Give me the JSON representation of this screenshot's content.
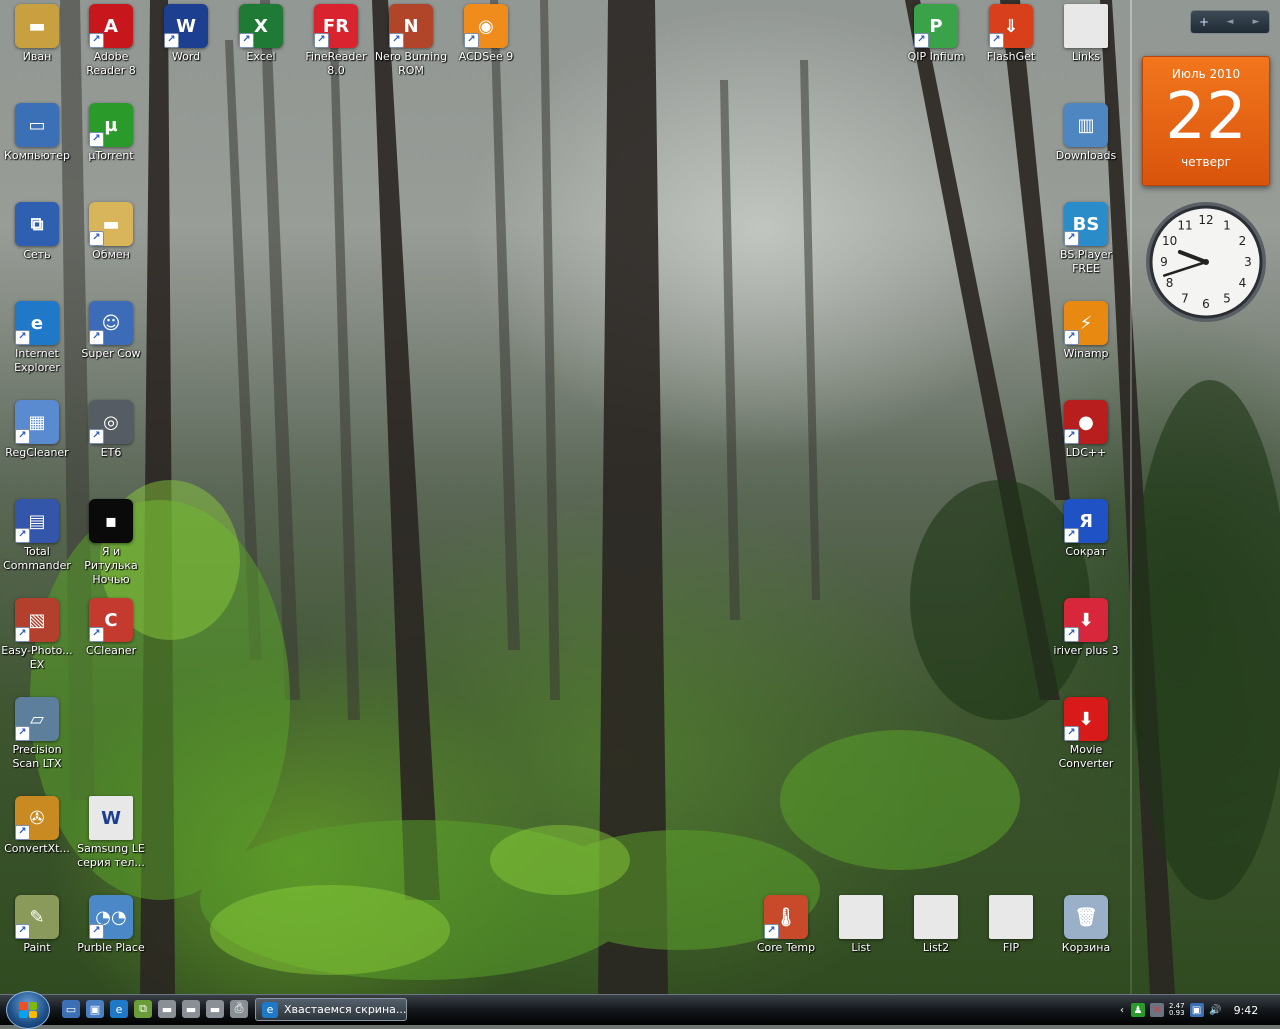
{
  "desktop": {
    "icons": [
      {
        "label": "Иван",
        "color": "#c8a040",
        "glyph": "▬",
        "shortcut": false
      },
      {
        "label": "Adobe Reader 8",
        "color": "#c8161d",
        "glyph": "A",
        "shortcut": true
      },
      {
        "label": "Word",
        "color": "#1d3f8f",
        "glyph": "W",
        "shortcut": true
      },
      {
        "label": "Excel",
        "color": "#1f7a35",
        "glyph": "X",
        "shortcut": true
      },
      {
        "label": "FineReader 8.0",
        "color": "#d9232e",
        "glyph": "FR",
        "shortcut": true
      },
      {
        "label": "Nero Burning ROM",
        "color": "#b0452a",
        "glyph": "N",
        "shortcut": true
      },
      {
        "label": "ACDSee 9",
        "color": "#f08c1c",
        "glyph": "◉",
        "shortcut": true
      },
      {
        "label": "Компьютер",
        "color": "#3b6fb6",
        "glyph": "▭",
        "shortcut": false
      },
      {
        "label": "µTorrent",
        "color": "#2a9b2a",
        "glyph": "µ",
        "shortcut": true
      },
      {
        "label": "Сеть",
        "color": "#2e5fb0",
        "glyph": "⧉",
        "shortcut": false
      },
      {
        "label": "Обмен",
        "color": "#d8b45a",
        "glyph": "▬",
        "shortcut": true
      },
      {
        "label": "Internet Explorer",
        "color": "#1f78c8",
        "glyph": "e",
        "shortcut": true
      },
      {
        "label": "Super Cow",
        "color": "#3c6cb8",
        "glyph": "☺",
        "shortcut": true
      },
      {
        "label": "RegCleaner",
        "color": "#5a8ad0",
        "glyph": "▦",
        "shortcut": true
      },
      {
        "label": "ET6",
        "color": "#555c63",
        "glyph": "◎",
        "shortcut": true
      },
      {
        "label": "Total Commander",
        "color": "#3355aa",
        "glyph": "▤",
        "shortcut": true
      },
      {
        "label": "Я и Ритулька Ночью",
        "color": "#0a0a0a",
        "glyph": "▪",
        "shortcut": false
      },
      {
        "label": "Easy-Photo... EX",
        "color": "#b2402c",
        "glyph": "▧",
        "shortcut": true
      },
      {
        "label": "CCleaner",
        "color": "#c43a2e",
        "glyph": "C",
        "shortcut": true
      },
      {
        "label": "Precision Scan LTX",
        "color": "#5d7f9c",
        "glyph": "▱",
        "shortcut": true
      },
      {
        "label": "ConvertXt...",
        "color": "#c98a22",
        "glyph": "✇",
        "shortcut": true
      },
      {
        "label": "Samsung LE серия тел...",
        "color": "#e8e8e8",
        "glyph": "W",
        "shortcut": false
      },
      {
        "label": "Paint",
        "color": "#8a9a5a",
        "glyph": "✎",
        "shortcut": true
      },
      {
        "label": "Purble Place",
        "color": "#4a88c8",
        "glyph": "◔◔",
        "shortcut": true
      },
      {
        "label": "QIP Infium",
        "color": "#3aa34a",
        "glyph": "P",
        "shortcut": true
      },
      {
        "label": "FlashGet",
        "color": "#d8401c",
        "glyph": "⇓",
        "shortcut": true
      },
      {
        "label": "Links",
        "color": "#e8e8e8",
        "glyph": "",
        "shortcut": false
      },
      {
        "label": "Downloads",
        "color": "#4d86c0",
        "glyph": "▥",
        "shortcut": false
      },
      {
        "label": "BS.Player FREE",
        "color": "#2a8cc8",
        "glyph": "BS",
        "shortcut": true
      },
      {
        "label": "Winamp",
        "color": "#e88a12",
        "glyph": "⚡",
        "shortcut": true
      },
      {
        "label": "LDC++",
        "color": "#b81e1e",
        "glyph": "●",
        "shortcut": true
      },
      {
        "label": "Сократ",
        "color": "#1f52c4",
        "glyph": "Я",
        "shortcut": true
      },
      {
        "label": "iriver plus 3",
        "color": "#d8263a",
        "glyph": "⬇",
        "shortcut": true
      },
      {
        "label": "Movie Converter",
        "color": "#d81a1a",
        "glyph": "⬇",
        "shortcut": true
      },
      {
        "label": "Core Temp",
        "color": "#c84a2a",
        "glyph": "🌡",
        "shortcut": true
      },
      {
        "label": "List",
        "color": "#e8e8e8",
        "glyph": "",
        "shortcut": false
      },
      {
        "label": "List2",
        "color": "#e8e8e8",
        "glyph": "",
        "shortcut": false
      },
      {
        "label": "FIP",
        "color": "#e8e8e8",
        "glyph": "",
        "shortcut": false
      },
      {
        "label": "Корзина",
        "color": "#9ab0c8",
        "glyph": "🗑",
        "shortcut": false
      }
    ]
  },
  "gadgets": {
    "toolbar": {
      "add": "+",
      "prev": "◄",
      "next": "►"
    },
    "calendar": {
      "month_year": "Июль 2010",
      "day": "22",
      "weekday": "четверг"
    },
    "clock": {
      "hour": 9,
      "minute": 42
    }
  },
  "taskbar": {
    "quick_launch": [
      {
        "name": "show-desktop",
        "color": "#3d6fb5",
        "glyph": "▭"
      },
      {
        "name": "switch-windows",
        "color": "#4a7fc1",
        "glyph": "▣"
      },
      {
        "name": "internet-explorer",
        "color": "#1f78c8",
        "glyph": "e"
      },
      {
        "name": "network",
        "color": "#6a9c3a",
        "glyph": "⧉"
      },
      {
        "name": "drive-1",
        "color": "#8a8f96",
        "glyph": "▬"
      },
      {
        "name": "drive-2",
        "color": "#8a8f96",
        "glyph": "▬"
      },
      {
        "name": "drive-3",
        "color": "#8a8f96",
        "glyph": "▬"
      },
      {
        "name": "printer",
        "color": "#8a8f96",
        "glyph": "⎙"
      }
    ],
    "more": "»",
    "task_button": "Хвастаемся скрина...",
    "tray": {
      "mini_top": "2.47",
      "mini_bottom": "0.93",
      "time": "9:42"
    }
  }
}
